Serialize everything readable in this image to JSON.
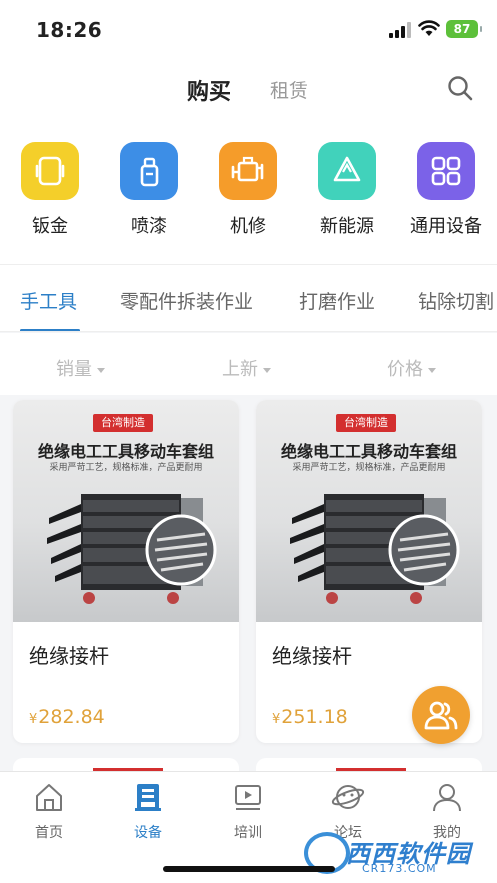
{
  "status": {
    "time": "18:26",
    "battery": "87"
  },
  "header": {
    "tabs": [
      {
        "label": "购买"
      },
      {
        "label": "租赁"
      }
    ]
  },
  "categories": [
    {
      "label": "钣金",
      "icon": "sheet-metal-icon",
      "color": "#f4cf2a"
    },
    {
      "label": "喷漆",
      "icon": "spray-paint-icon",
      "color": "#3d8ee6"
    },
    {
      "label": "机修",
      "icon": "engine-icon",
      "color": "#f59c2a"
    },
    {
      "label": "新能源",
      "icon": "recycle-icon",
      "color": "#41d2bb"
    },
    {
      "label": "通用设备",
      "icon": "grid-icon",
      "color": "#7b62e8"
    }
  ],
  "subtabs": [
    {
      "label": "手工具"
    },
    {
      "label": "零配件拆装作业"
    },
    {
      "label": "打磨作业"
    },
    {
      "label": "钻除切割"
    }
  ],
  "sort": [
    {
      "label": "销量"
    },
    {
      "label": "上新"
    },
    {
      "label": "价格"
    }
  ],
  "products": [
    {
      "tag": "台湾制造",
      "headline": "绝缘电工工具移动车套组",
      "sub": "采用严苛工艺，规格标准，产品更耐用",
      "name": "绝缘接杆",
      "currency": "¥",
      "price": "282.84"
    },
    {
      "tag": "台湾制造",
      "headline": "绝缘电工工具移动车套组",
      "sub": "采用严苛工艺，规格标准，产品更耐用",
      "name": "绝缘接杆",
      "currency": "¥",
      "price": "251.18"
    }
  ],
  "nav": [
    {
      "label": "首页",
      "icon": "home-icon"
    },
    {
      "label": "设备",
      "icon": "device-icon"
    },
    {
      "label": "培训",
      "icon": "training-icon"
    },
    {
      "label": "论坛",
      "icon": "forum-icon"
    },
    {
      "label": "我的",
      "icon": "profile-icon"
    }
  ],
  "watermark": {
    "name": "西西软件园",
    "url": "CR173.COM"
  },
  "colors": {
    "accent": "#2c7fc7",
    "price": "#e0a23a",
    "fab": "#f0a030"
  }
}
